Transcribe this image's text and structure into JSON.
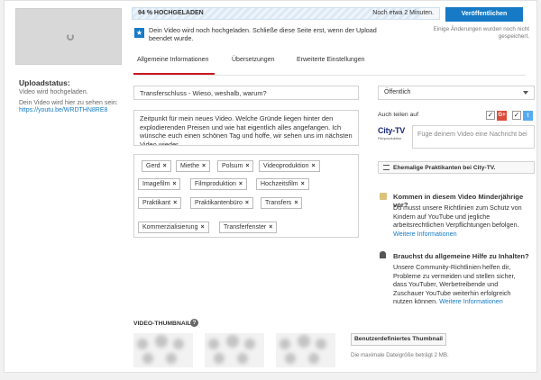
{
  "sidebar": {
    "status_label": "Uploadstatus:",
    "status_text": "Video wird hochgeladen.",
    "link_text": "Dein Video wird hier zu sehen sein:",
    "link_url": "https://youtu.be/WRDTHN8RE8"
  },
  "upload": {
    "progress_label": "94 % HOCHGELADEN",
    "progress_percent": 94,
    "remaining": "Noch etwa 2 Minuten.",
    "publish_label": "Veröffentlichen",
    "notice": "Dein Video wird noch hochgeladen. Schließe diese Seite erst, wenn der Upload beendet wurde.",
    "save_hint": "Einige Änderungen wurden noch nicht gespeichert."
  },
  "tabs": [
    {
      "label": "Allgemeine Informationen",
      "active": true
    },
    {
      "label": "Übersetzungen",
      "active": false
    },
    {
      "label": "Erweiterte Einstellungen",
      "active": false
    }
  ],
  "form": {
    "title": "Transferschluss - Wieso, weshalb, warum?",
    "description": "Zeitpunkt für mein neues Video. Welche Gründe liegen hinter den explodierenden Preisen und wie hat eigentlich alles angefangen. Ich wünsche euch einen schönen Tag und hoffe, wir sehen uns im nächsten Video wieder.",
    "tags": [
      "Gerd",
      "Miethe",
      "Polsum",
      "Videoproduktion",
      "Imagefilm",
      "Filmproduktion",
      "Hochzeitsfilm",
      "Praktikant",
      "Praktikantenbüro",
      "Transfers",
      "Kommerzialisierung",
      "Transferfenster"
    ],
    "tag_remove_glyph": "×"
  },
  "right": {
    "privacy": "Öffentlich",
    "share_label": "Auch teilen auf",
    "gplus_label": "G+",
    "twitter_glyph": "t",
    "check_glyph": "✓",
    "channel_name": "City-TV",
    "channel_sub": "Filmproduktion",
    "message_placeholder": "Füge deinem Video eine Nachricht bei",
    "playlist_label": "Ehemalige Praktikanten bei City-TV.",
    "minors_title": "Kommen in diesem Video Minderjährige vor?",
    "minors_body": "Du musst unsere Richtlinien zum Schutz von Kindern auf YouTube und jegliche arbeitsrechtlichen Verpflichtungen befolgen.",
    "minors_link": "Weitere Informationen",
    "help_title": "Brauchst du allgemeine Hilfe zu Inhalten?",
    "help_body": "Unsere Community-Richtlinien helfen dir, Probleme zu vermeiden und stellen sicher, dass YouTuber, Werbetreibende und Zuschauer YouTube weiterhin erfolgreich nutzen können.",
    "help_link": "Weitere Informationen"
  },
  "thumbnails": {
    "label": "VIDEO-THUMBNAILS",
    "help_glyph": "?",
    "custom_button": "Benutzerdefiniertes Thumbnail",
    "max_size": "Die maximale Dateigröße beträgt 2 MB."
  },
  "colors": {
    "accent": "#167ac6",
    "tab_active": "#cc181e",
    "gplus": "#dd4b39",
    "twitter": "#55acee"
  }
}
